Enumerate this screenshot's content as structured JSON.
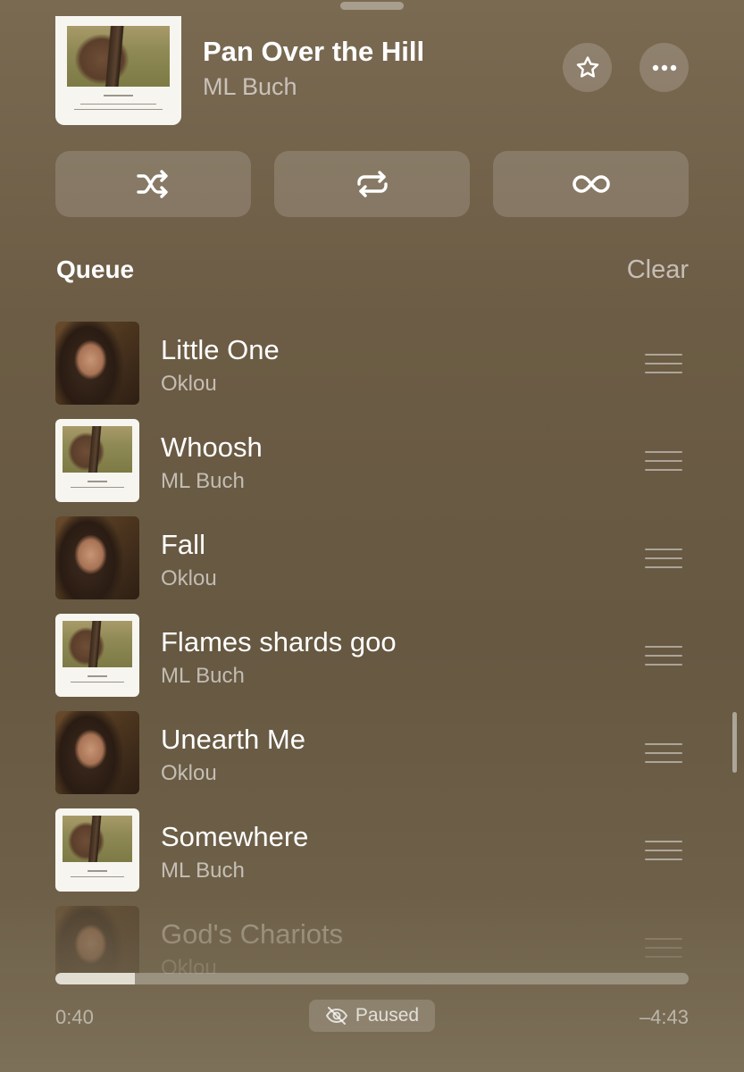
{
  "now_playing": {
    "title": "Pan Over the Hill",
    "artist": "ML Buch",
    "artwork_icon": "album-art-ml-buch"
  },
  "controls": {
    "shuffle_icon": "shuffle-icon",
    "repeat_icon": "repeat-icon",
    "autoplay_icon": "infinity-icon",
    "favorite_icon": "star-icon",
    "more_icon": "ellipsis-icon"
  },
  "queue": {
    "label": "Queue",
    "clear_label": "Clear",
    "items": [
      {
        "title": "Little One",
        "artist": "Oklou",
        "art": "oklou"
      },
      {
        "title": "Whoosh",
        "artist": "ML Buch",
        "art": "mlbuch"
      },
      {
        "title": "Fall",
        "artist": "Oklou",
        "art": "oklou"
      },
      {
        "title": "Flames shards goo",
        "artist": "ML Buch",
        "art": "mlbuch"
      },
      {
        "title": "Unearth Me",
        "artist": "Oklou",
        "art": "oklou"
      },
      {
        "title": "Somewhere",
        "artist": "ML Buch",
        "art": "mlbuch"
      },
      {
        "title": "God's Chariots",
        "artist": "Oklou",
        "art": "oklou"
      }
    ]
  },
  "playback": {
    "elapsed": "0:40",
    "remaining": "–4:43",
    "progress_fraction": 0.125,
    "status": "Paused",
    "status_icon": "listening-history-off-icon"
  },
  "colors": {
    "background": "#6c5c45",
    "text_primary": "#ffffff",
    "text_secondary": "rgba(255,255,255,0.6)"
  }
}
